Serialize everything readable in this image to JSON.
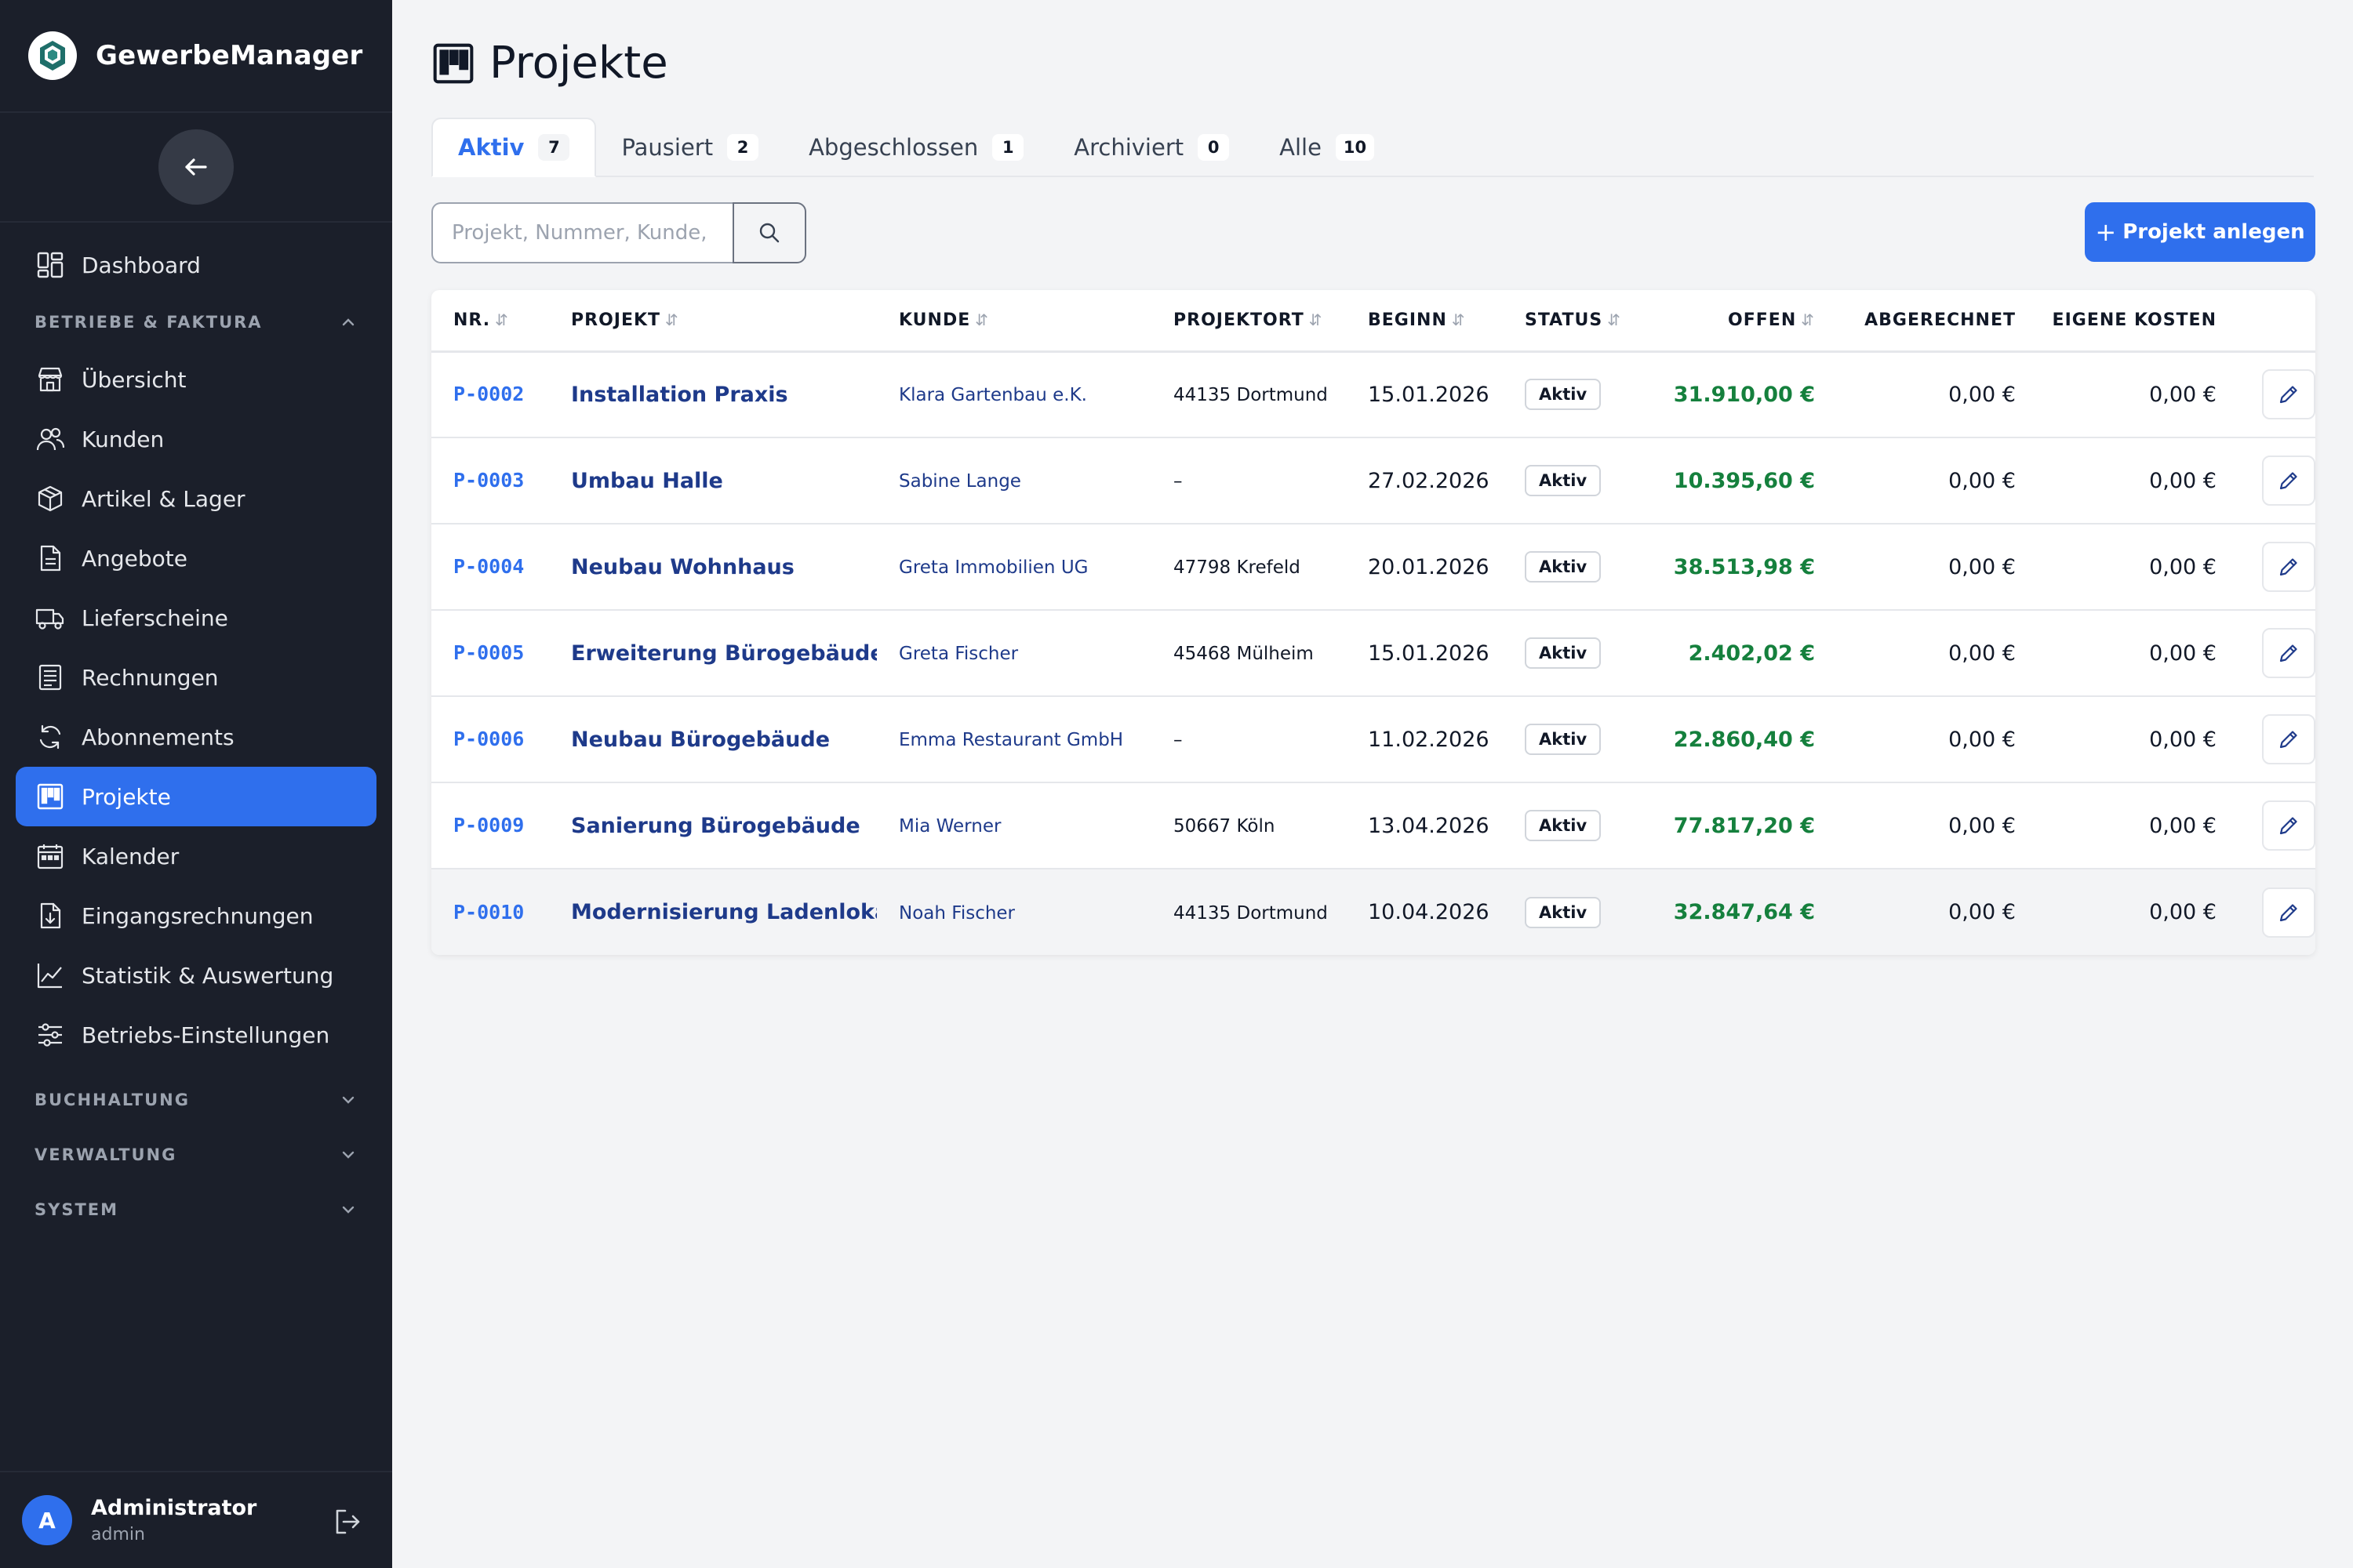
{
  "app": {
    "name": "GewerbeManager"
  },
  "sidebar": {
    "top_items": [
      {
        "label": "Dashboard",
        "icon": "dashboard-icon"
      }
    ],
    "sections": [
      {
        "label": "BETRIEBE & FAKTURA",
        "expanded": true,
        "items": [
          {
            "label": "Übersicht",
            "icon": "store-icon"
          },
          {
            "label": "Kunden",
            "icon": "users-icon"
          },
          {
            "label": "Artikel & Lager",
            "icon": "box-icon"
          },
          {
            "label": "Angebote",
            "icon": "document-icon"
          },
          {
            "label": "Lieferscheine",
            "icon": "truck-icon"
          },
          {
            "label": "Rechnungen",
            "icon": "invoice-icon"
          },
          {
            "label": "Abonnements",
            "icon": "refresh-icon"
          },
          {
            "label": "Projekte",
            "icon": "kanban-icon",
            "active": true
          },
          {
            "label": "Kalender",
            "icon": "calendar-icon"
          },
          {
            "label": "Eingangsrechnungen",
            "icon": "inbox-document-icon"
          },
          {
            "label": "Statistik & Auswertung",
            "icon": "chart-line-icon"
          },
          {
            "label": "Betriebs-Einstellungen",
            "icon": "sliders-icon"
          }
        ]
      },
      {
        "label": "BUCHHALTUNG",
        "expanded": false
      },
      {
        "label": "VERWALTUNG",
        "expanded": false
      },
      {
        "label": "SYSTEM",
        "expanded": false
      }
    ]
  },
  "user": {
    "initial": "A",
    "name": "Administrator",
    "role": "admin"
  },
  "page": {
    "title": "Projekte"
  },
  "tabs": [
    {
      "label": "Aktiv",
      "count": "7",
      "active": true
    },
    {
      "label": "Pausiert",
      "count": "2"
    },
    {
      "label": "Abgeschlossen",
      "count": "1"
    },
    {
      "label": "Archiviert",
      "count": "0"
    },
    {
      "label": "Alle",
      "count": "10"
    }
  ],
  "search": {
    "placeholder": "Projekt, Nummer, Kunde, O",
    "value": ""
  },
  "add_button": {
    "label": "Projekt anlegen"
  },
  "table": {
    "columns": [
      {
        "label": "NR.",
        "sortable": true
      },
      {
        "label": "PROJEKT",
        "sortable": true
      },
      {
        "label": "KUNDE",
        "sortable": true
      },
      {
        "label": "PROJEKTORT",
        "sortable": true
      },
      {
        "label": "BEGINN",
        "sortable": true
      },
      {
        "label": "STATUS",
        "sortable": true
      },
      {
        "label": "OFFEN",
        "sortable": true
      },
      {
        "label": "ABGERECHNET",
        "sortable": false
      },
      {
        "label": "EIGENE KOSTEN",
        "sortable": false
      }
    ],
    "rows": [
      {
        "nr": "P-0002",
        "projekt": "Installation Praxis",
        "kunde": "Klara Gartenbau e.K.",
        "ort": "44135 Dortmund",
        "beginn": "15.01.2026",
        "status": "Aktiv",
        "offen": "31.910,00 €",
        "abgerechnet": "0,00 €",
        "kosten": "0,00 €"
      },
      {
        "nr": "P-0003",
        "projekt": "Umbau Halle",
        "kunde": "Sabine Lange",
        "ort": "–",
        "beginn": "27.02.2026",
        "status": "Aktiv",
        "offen": "10.395,60 €",
        "abgerechnet": "0,00 €",
        "kosten": "0,00 €"
      },
      {
        "nr": "P-0004",
        "projekt": "Neubau Wohnhaus",
        "kunde": "Greta Immobilien UG",
        "ort": "47798 Krefeld",
        "beginn": "20.01.2026",
        "status": "Aktiv",
        "offen": "38.513,98 €",
        "abgerechnet": "0,00 €",
        "kosten": "0,00 €"
      },
      {
        "nr": "P-0005",
        "projekt": "Erweiterung Bürogebäude",
        "kunde": "Greta Fischer",
        "ort": "45468 Mülheim",
        "beginn": "15.01.2026",
        "status": "Aktiv",
        "offen": "2.402,02 €",
        "abgerechnet": "0,00 €",
        "kosten": "0,00 €"
      },
      {
        "nr": "P-0006",
        "projekt": "Neubau Bürogebäude",
        "kunde": "Emma Restaurant GmbH",
        "ort": "–",
        "beginn": "11.02.2026",
        "status": "Aktiv",
        "offen": "22.860,40 €",
        "abgerechnet": "0,00 €",
        "kosten": "0,00 €"
      },
      {
        "nr": "P-0009",
        "projekt": "Sanierung Bürogebäude",
        "kunde": "Mia Werner",
        "ort": "50667 Köln",
        "beginn": "13.04.2026",
        "status": "Aktiv",
        "offen": "77.817,20 €",
        "abgerechnet": "0,00 €",
        "kosten": "0,00 €"
      },
      {
        "nr": "P-0010",
        "projekt": "Modernisierung Ladenlokal",
        "kunde": "Noah Fischer",
        "ort": "44135 Dortmund",
        "beginn": "10.04.2026",
        "status": "Aktiv",
        "offen": "32.847,64 €",
        "abgerechnet": "0,00 €",
        "kosten": "0,00 €"
      }
    ]
  },
  "colors": {
    "accent": "#2f6fed",
    "sidebar_bg": "#1b1f2a",
    "amount_open": "#15803d",
    "link": "#1e3a8a"
  }
}
